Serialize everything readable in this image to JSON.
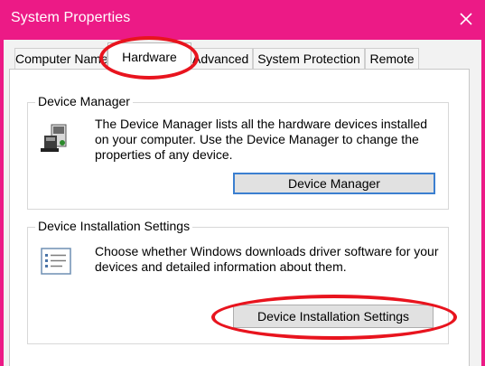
{
  "window": {
    "title": "System Properties",
    "close_icon": "close-icon",
    "accent_color": "#ec1a86"
  },
  "tabs": [
    {
      "label": "Computer Name",
      "selected": false
    },
    {
      "label": "Hardware",
      "selected": true
    },
    {
      "label": "Advanced",
      "selected": false
    },
    {
      "label": "System Protection",
      "selected": false
    },
    {
      "label": "Remote",
      "selected": false
    }
  ],
  "device_manager": {
    "group_label": "Device Manager",
    "icon": "device-manager-icon",
    "line1": "The Device Manager lists all the hardware devices installed",
    "line2": "on your computer. Use the Device Manager to change the",
    "line3": "properties of any device.",
    "button_label": "Device Manager"
  },
  "device_installation": {
    "group_label": "Device Installation Settings",
    "icon": "settings-list-icon",
    "line1": "Choose whether Windows downloads driver software for your",
    "line2": "devices and detailed information about them.",
    "button_label": "Device Installation Settings"
  },
  "highlight_color": "#e8141e"
}
